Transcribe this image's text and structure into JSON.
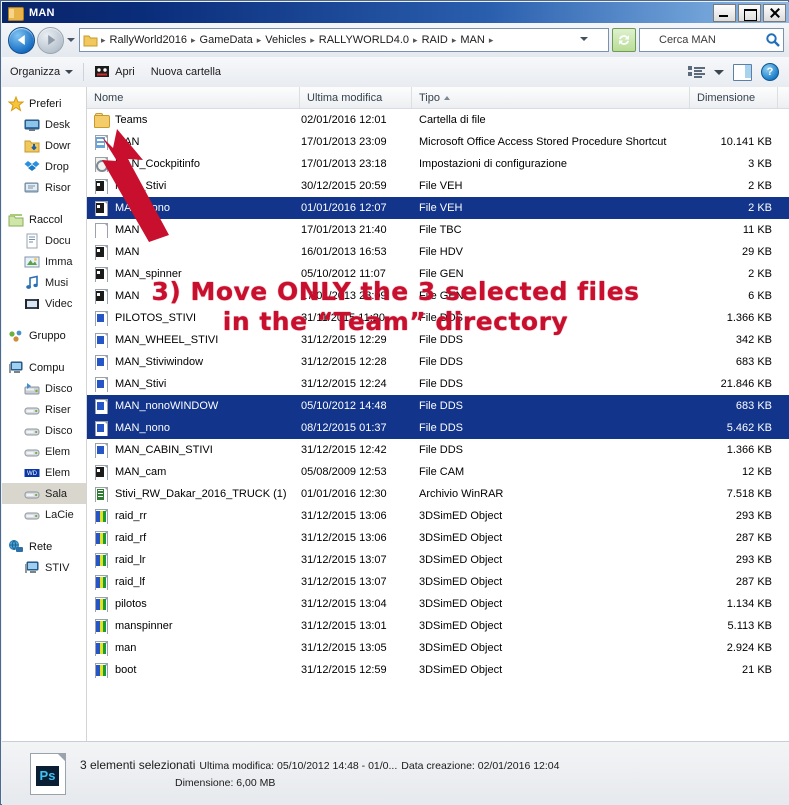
{
  "window": {
    "title": "MAN",
    "icon": "folder-icon",
    "controls": {
      "minimize": "minimize-button",
      "maximize": "maximize-button",
      "close": "close-button"
    }
  },
  "address_bar": {
    "back": "back-button",
    "forward": "forward-button",
    "history_dropdown": "history-dropdown",
    "crumbs": [
      "RallyWorld2016",
      "GameData",
      "Vehicles",
      "RALLYWORLD4.0",
      "RAID",
      "MAN"
    ],
    "separator": "▸",
    "refresh": "refresh-button",
    "search_value": "Cerca MAN",
    "search_placeholder": "Cerca MAN"
  },
  "toolbar": {
    "organize": "Organizza",
    "open": "Apri",
    "new_folder": "Nuova cartella",
    "view_icon": "view-options-icon",
    "view_dropdown": "view-dropdown-arrow",
    "preview_pane": "preview-pane-icon",
    "help": "?"
  },
  "nav_pane": {
    "groups": [
      {
        "header": {
          "label": "Preferi",
          "icon": "star-icon"
        },
        "items": [
          {
            "label": "Desk",
            "icon": "desktop-icon"
          },
          {
            "label": "Dowr",
            "icon": "downloads-icon"
          },
          {
            "label": "Drop",
            "icon": "dropbox-icon"
          },
          {
            "label": "Risor",
            "icon": "recent-places-icon"
          }
        ]
      },
      {
        "header": {
          "label": "Raccol",
          "icon": "libraries-icon"
        },
        "items": [
          {
            "label": "Docu",
            "icon": "documents-icon"
          },
          {
            "label": "Imma",
            "icon": "pictures-icon"
          },
          {
            "label": "Musi",
            "icon": "music-icon"
          },
          {
            "label": "Videc",
            "icon": "videos-icon"
          }
        ]
      },
      {
        "header": {
          "label": "Gruppo",
          "icon": "homegroup-icon"
        },
        "items": []
      },
      {
        "header": {
          "label": "Compu",
          "icon": "computer-icon"
        },
        "items": [
          {
            "label": "Disco",
            "icon": "system-drive-icon"
          },
          {
            "label": "Riser",
            "icon": "drive-icon"
          },
          {
            "label": "Disco",
            "icon": "drive-icon"
          },
          {
            "label": "Elem",
            "icon": "drive-icon"
          },
          {
            "label": "Elem",
            "icon": "wd-drive-icon"
          },
          {
            "label": "Sala",
            "icon": "drive-icon",
            "selected": true
          },
          {
            "label": "LaCie",
            "icon": "drive-icon"
          }
        ]
      },
      {
        "header": {
          "label": "Rete",
          "icon": "network-icon"
        },
        "items": [
          {
            "label": "STIV",
            "icon": "computer-icon"
          }
        ]
      }
    ]
  },
  "file_list": {
    "columns": [
      {
        "key": "name",
        "label": "Nome"
      },
      {
        "key": "date",
        "label": "Ultima modifica"
      },
      {
        "key": "type",
        "label": "Tipo",
        "sorted": true
      },
      {
        "key": "size",
        "label": "Dimensione"
      }
    ],
    "rows": [
      {
        "name": "Teams",
        "date": "02/01/2016 12:01",
        "type": "Cartella di file",
        "size": "",
        "icon": "folder-icon",
        "selected": false
      },
      {
        "name": "MAN",
        "date": "17/01/2013 23:09",
        "type": "Microsoft Office Access Stored Procedure Shortcut",
        "size": "10.141 KB",
        "icon": "access-shortcut-icon",
        "selected": false
      },
      {
        "name": "MAN_Cockpitinfo",
        "date": "17/01/2013 23:18",
        "type": "Impostazioni di configurazione",
        "size": "3 KB",
        "icon": "config-icon",
        "selected": false
      },
      {
        "name": "MAN_Stivi",
        "date": "30/12/2015 20:59",
        "type": "File VEH",
        "size": "2 KB",
        "icon": "veh-icon",
        "selected": false
      },
      {
        "name": "MAN_nono",
        "date": "01/01/2016 12:07",
        "type": "File VEH",
        "size": "2 KB",
        "icon": "veh-icon",
        "selected": true
      },
      {
        "name": "MAN",
        "date": "17/01/2013 21:40",
        "type": "File TBC",
        "size": "11 KB",
        "icon": "blank-file-icon",
        "selected": false
      },
      {
        "name": "MAN",
        "date": "16/01/2013 16:53",
        "type": "File HDV",
        "size": "29 KB",
        "icon": "veh-icon",
        "selected": false
      },
      {
        "name": "MAN_spinner",
        "date": "05/10/2012 11:07",
        "type": "File GEN",
        "size": "2 KB",
        "icon": "veh-icon",
        "selected": false
      },
      {
        "name": "MAN",
        "date": "17/01/2013 23:09",
        "type": "File GEN",
        "size": "6 KB",
        "icon": "veh-icon",
        "selected": false
      },
      {
        "name": "PILOTOS_STIVI",
        "date": "31/11/2015 11:20",
        "type": "File DDS",
        "size": "1.366 KB",
        "icon": "dds-icon",
        "selected": false
      },
      {
        "name": "MAN_WHEEL_STIVI",
        "date": "31/12/2015 12:29",
        "type": "File DDS",
        "size": "342 KB",
        "icon": "dds-icon",
        "selected": false
      },
      {
        "name": "MAN_Stiviwindow",
        "date": "31/12/2015 12:28",
        "type": "File DDS",
        "size": "683 KB",
        "icon": "dds-icon",
        "selected": false
      },
      {
        "name": "MAN_Stivi",
        "date": "31/12/2015 12:24",
        "type": "File DDS",
        "size": "21.846 KB",
        "icon": "dds-icon",
        "selected": false
      },
      {
        "name": "MAN_nonoWINDOW",
        "date": "05/10/2012 14:48",
        "type": "File DDS",
        "size": "683 KB",
        "icon": "dds-icon",
        "selected": true
      },
      {
        "name": "MAN_nono",
        "date": "08/12/2015 01:37",
        "type": "File DDS",
        "size": "5.462 KB",
        "icon": "dds-icon",
        "selected": true
      },
      {
        "name": "MAN_CABIN_STIVI",
        "date": "31/12/2015 12:42",
        "type": "File DDS",
        "size": "1.366 KB",
        "icon": "dds-icon",
        "selected": false
      },
      {
        "name": "MAN_cam",
        "date": "05/08/2009 12:53",
        "type": "File CAM",
        "size": "12 KB",
        "icon": "veh-icon",
        "selected": false
      },
      {
        "name": "Stivi_RW_Dakar_2016_TRUCK (1)",
        "date": "01/01/2016 12:30",
        "type": "Archivio WinRAR",
        "size": "7.518 KB",
        "icon": "winrar-icon",
        "selected": false
      },
      {
        "name": "raid_rr",
        "date": "31/12/2015 13:06",
        "type": "3DSimED Object",
        "size": "293 KB",
        "icon": "3dsimed-icon",
        "selected": false
      },
      {
        "name": "raid_rf",
        "date": "31/12/2015 13:06",
        "type": "3DSimED Object",
        "size": "287 KB",
        "icon": "3dsimed-icon",
        "selected": false
      },
      {
        "name": "raid_lr",
        "date": "31/12/2015 13:07",
        "type": "3DSimED Object",
        "size": "293 KB",
        "icon": "3dsimed-icon",
        "selected": false
      },
      {
        "name": "raid_lf",
        "date": "31/12/2015 13:07",
        "type": "3DSimED Object",
        "size": "287 KB",
        "icon": "3dsimed-icon",
        "selected": false
      },
      {
        "name": "pilotos",
        "date": "31/12/2015 13:04",
        "type": "3DSimED Object",
        "size": "1.134 KB",
        "icon": "3dsimed-icon",
        "selected": false
      },
      {
        "name": "manspinner",
        "date": "31/12/2015 13:01",
        "type": "3DSimED Object",
        "size": "5.113 KB",
        "icon": "3dsimed-icon",
        "selected": false
      },
      {
        "name": "man",
        "date": "31/12/2015 13:05",
        "type": "3DSimED Object",
        "size": "2.924 KB",
        "icon": "3dsimed-icon",
        "selected": false
      },
      {
        "name": "boot",
        "date": "31/12/2015 12:59",
        "type": "3DSimED Object",
        "size": "21 KB",
        "icon": "3dsimed-icon",
        "selected": false
      }
    ]
  },
  "annotation": {
    "line1": "3) Move ONLY the 3 selected files",
    "line2": "in the “Team” directory",
    "color": "#c8102e",
    "arrow": "red-arrow-pointing-to-teams-folder"
  },
  "status_bar": {
    "icon": "photoshop-file-icon",
    "icon_label": "Ps",
    "selection": "3 elementi selezionati",
    "modified": "Ultima modifica: 05/10/2012 14:48 - 01/0...",
    "created": "Data creazione: 02/01/2016 12:04",
    "size": "Dimensione: 6,00 MB"
  },
  "colors": {
    "selection_blue": "#12348a",
    "title_blue": "#0a246a",
    "annotation_red": "#c8102e"
  }
}
